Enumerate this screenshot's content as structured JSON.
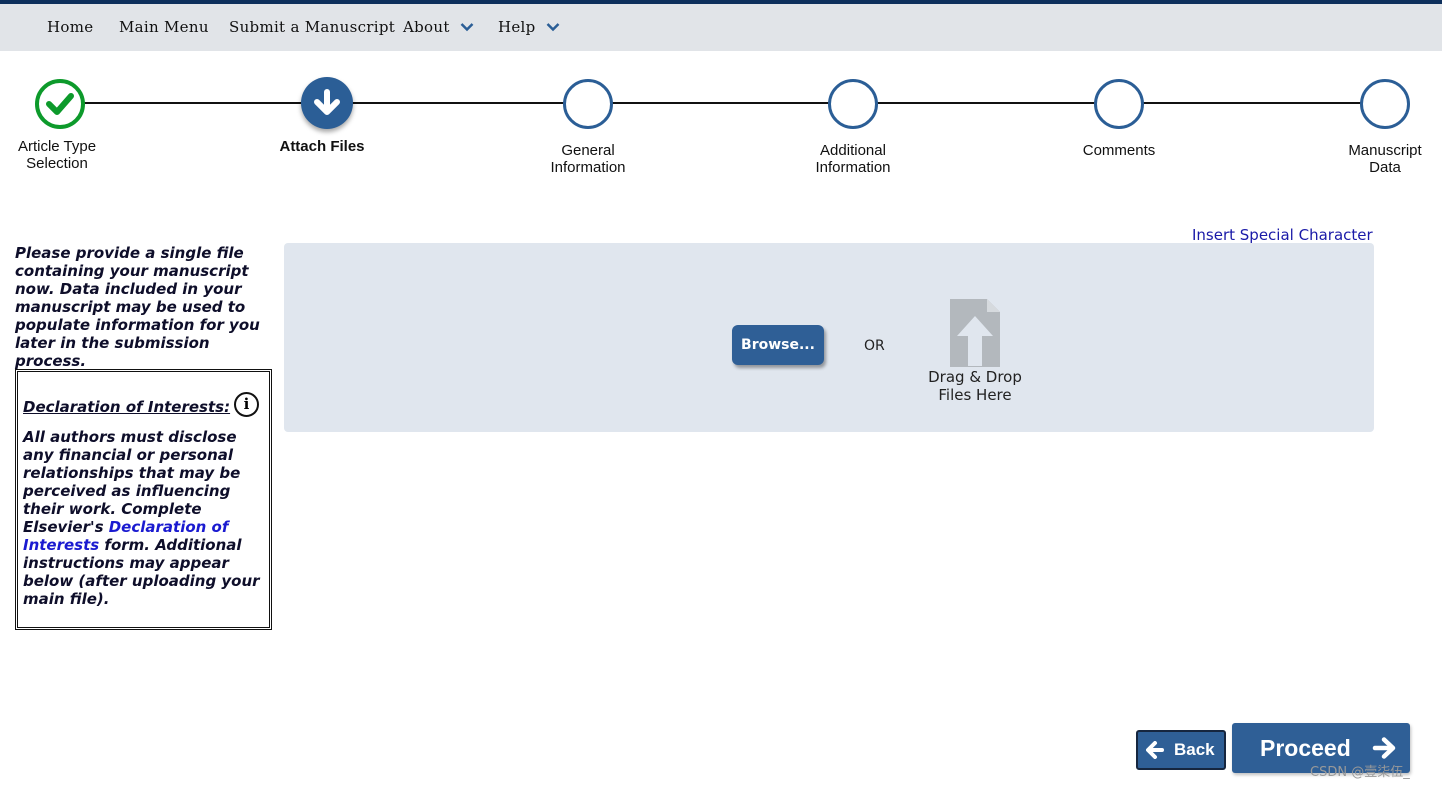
{
  "nav": {
    "items": [
      {
        "label": "Home",
        "has_dropdown": false
      },
      {
        "label": "Main Menu",
        "has_dropdown": false
      },
      {
        "label": "Submit a Manuscript",
        "has_dropdown": false
      },
      {
        "label": "About",
        "has_dropdown": true
      },
      {
        "label": "Help",
        "has_dropdown": true
      }
    ],
    "dropdown_icon": "chevron-down-icon"
  },
  "steps": [
    {
      "label_line1": "Article Type",
      "label_line2": "Selection",
      "state": "done",
      "icon": "checkmark-icon"
    },
    {
      "label_line1": "Attach Files",
      "label_line2": "",
      "state": "current",
      "icon": "arrow-down-icon"
    },
    {
      "label_line1": "General",
      "label_line2": "Information",
      "state": "pending",
      "icon": ""
    },
    {
      "label_line1": "Additional",
      "label_line2": "Information",
      "state": "pending",
      "icon": ""
    },
    {
      "label_line1": "Comments",
      "label_line2": "",
      "state": "pending",
      "icon": ""
    },
    {
      "label_line1": "Manuscript",
      "label_line2": "Data",
      "state": "pending",
      "icon": ""
    }
  ],
  "insert_special_character": "Insert Special Character",
  "instructions": "Please provide a single file containing your manuscript now. Data included in your manuscript may be used to populate information for you later in the submission process.",
  "declaration": {
    "title": "Declaration of Interests:",
    "info_icon": "info-icon",
    "body_before_link": "All authors must disclose any financial or personal relationships that may be perceived as influencing their work. Complete Elsevier's ",
    "link_text": "Declaration of Interests",
    "body_after_link": " form. Additional instructions may appear below (after uploading your main file)."
  },
  "upload": {
    "browse_label": "Browse...",
    "or_text": "OR",
    "drag_drop_line1": "Drag & Drop",
    "drag_drop_line2": "Files Here",
    "drag_drop_icon": "file-upload-icon"
  },
  "buttons": {
    "back_label": "Back",
    "proceed_label": "Proceed"
  },
  "watermark": "CSDN @壹柒伍_",
  "colors": {
    "accent": "#2f5f96",
    "done": "#0d9a2b",
    "nav_bg": "#e1e4e8",
    "upload_bg": "#e0e6ee",
    "link": "#1a1ad0"
  }
}
